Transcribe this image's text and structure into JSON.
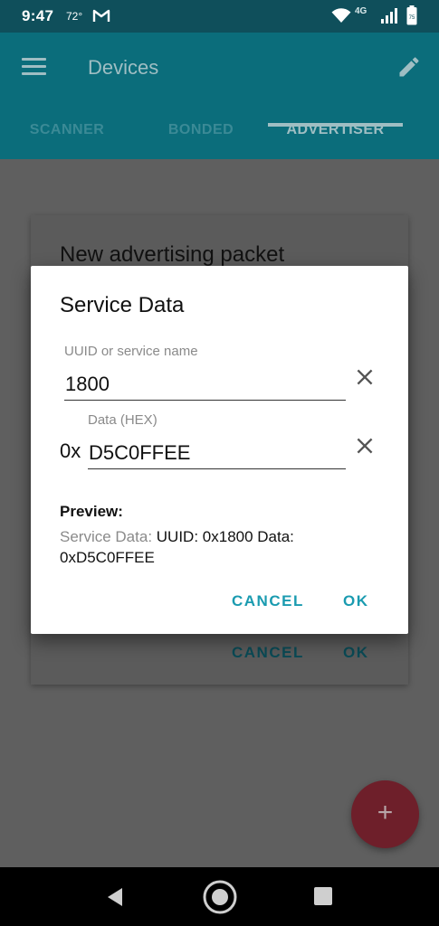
{
  "status_bar": {
    "time": "9:47",
    "temperature": "72°",
    "network_label": "4G",
    "battery_level_text": "75",
    "icons": [
      "gmail-icon",
      "wifi-icon",
      "signal-icon",
      "battery-icon"
    ]
  },
  "app_bar": {
    "title": "Devices",
    "tabs": [
      {
        "label": "SCANNER",
        "active": false
      },
      {
        "label": "BONDED",
        "active": false
      },
      {
        "label": "ADVERTISER",
        "active": true
      }
    ]
  },
  "background_dialog": {
    "title": "New advertising packet",
    "cancel_label": "CANCEL",
    "ok_label": "OK"
  },
  "dialog": {
    "title": "Service Data",
    "uuid_field": {
      "label": "UUID or service name",
      "value": "1800"
    },
    "data_field": {
      "label": "Data (HEX)",
      "prefix": "0x",
      "value": "D5C0FFEE"
    },
    "preview_label": "Preview:",
    "preview_key": "Service Data:",
    "preview_value": "UUID: 0x1800 Data: 0xD5C0FFEE",
    "cancel_label": "CANCEL",
    "ok_label": "OK"
  },
  "fab": {
    "symbol": "+"
  },
  "colors": {
    "primary": "#0b6d7b",
    "primary_dark": "#0f4f5b",
    "accent_text": "#1a9bb0",
    "fab": "#6e1f2a"
  }
}
